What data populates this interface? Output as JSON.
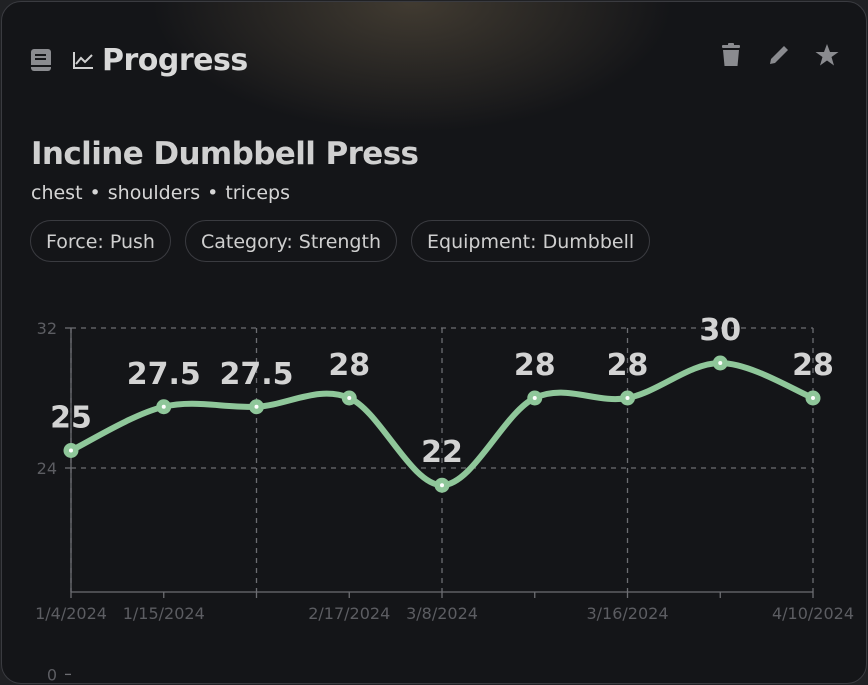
{
  "header": {
    "title": "Progress",
    "icons": [
      "book-icon",
      "trending-up-icon"
    ]
  },
  "actions": [
    "trash-icon",
    "pencil-icon",
    "star-icon"
  ],
  "exercise": {
    "name": "Incline Dumbbell Press",
    "muscles": [
      "chest",
      "shoulders",
      "triceps"
    ],
    "separator": "•",
    "tags": [
      "Force: Push",
      "Category: Strength",
      "Equipment: Dumbbell"
    ]
  },
  "colors": {
    "accent": "#8fc79a",
    "background": "#141518",
    "text": "#d3d3d3"
  },
  "chart_data": {
    "type": "line",
    "points": [
      {
        "date": "1/4/2024",
        "value": 25,
        "label": "25"
      },
      {
        "date": "1/15/2024",
        "value": 27.5,
        "label": "27.5"
      },
      {
        "date": "",
        "value": 27.5,
        "label": "27.5"
      },
      {
        "date": "2/17/2024",
        "value": 28,
        "label": "28"
      },
      {
        "date": "3/8/2024",
        "value": 22,
        "label": "22"
      },
      {
        "date": "",
        "value": 28,
        "label": "28"
      },
      {
        "date": "3/16/2024",
        "value": 28,
        "label": "28"
      },
      {
        "date": "",
        "value": 30,
        "label": "30"
      },
      {
        "date": "4/10/2024",
        "value": 28,
        "label": "28"
      }
    ],
    "y_ticks": [
      "0",
      "24",
      "32"
    ],
    "y_scale": "broken axis: 0, 24, 32 shown",
    "grid": "dashed",
    "color": "#8fc79a"
  }
}
